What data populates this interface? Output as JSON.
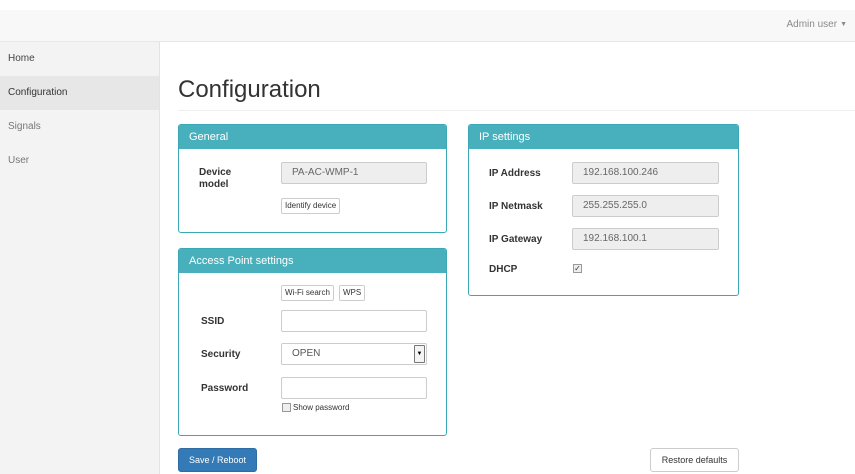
{
  "header": {
    "user_menu": "Admin user"
  },
  "sidebar": {
    "items": [
      {
        "label": "Home"
      },
      {
        "label": "Configuration"
      },
      {
        "label": "Signals"
      },
      {
        "label": "User"
      }
    ]
  },
  "page": {
    "title": "Configuration"
  },
  "general": {
    "title": "General",
    "device_model_label": "Device model",
    "device_model_value": "PA-AC-WMP-1",
    "identify_button": "Identify device"
  },
  "access_point": {
    "title": "Access Point settings",
    "wifi_search_button": "Wi-Fi search",
    "wps_button": "WPS",
    "ssid_label": "SSID",
    "ssid_value": "",
    "security_label": "Security",
    "security_value": "OPEN",
    "password_label": "Password",
    "password_value": "",
    "show_password_label": "Show password"
  },
  "ip_settings": {
    "title": "IP settings",
    "address_label": "IP Address",
    "address_value": "192.168.100.246",
    "netmask_label": "IP Netmask",
    "netmask_value": "255.255.255.0",
    "gateway_label": "IP Gateway",
    "gateway_value": "192.168.100.1",
    "dhcp_label": "DHCP",
    "dhcp_checked": true
  },
  "actions": {
    "save_button": "Save / Reboot",
    "restore_button": "Restore defaults"
  },
  "colors": {
    "panel_heading": "#48b0bc",
    "primary_button": "#337ab7"
  }
}
